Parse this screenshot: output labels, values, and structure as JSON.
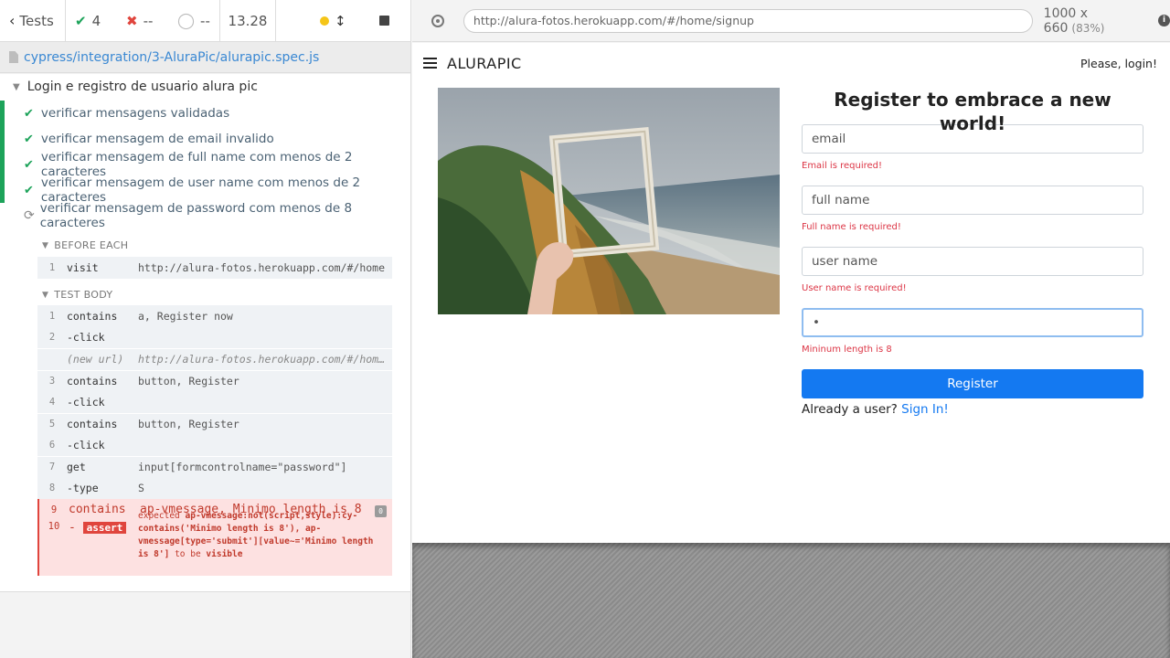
{
  "reporter": {
    "stats": {
      "back_label": "Tests",
      "passed": "4",
      "failed": "--",
      "pending": "--",
      "duration": "13.28"
    },
    "spec_path": "cypress/integration/3-AluraPic/alurapic.spec.js",
    "suite_title": "Login e registro de usuario alura pic",
    "tests": [
      {
        "title": "verificar mensagens validadas",
        "state": "passed"
      },
      {
        "title": "verificar mensagem de email invalido",
        "state": "passed"
      },
      {
        "title": "verificar mensagem de full name com menos de 2 caracteres",
        "state": "passed"
      },
      {
        "title": "verificar mensagem de user name com menos de 2 caracteres",
        "state": "passed"
      },
      {
        "title": "verificar mensagem de password com menos de 8 caracteres",
        "state": "running"
      }
    ],
    "before_each_label": "BEFORE EACH",
    "before_each": [
      {
        "n": "1",
        "name": "visit",
        "msg": "http://alura-fotos.herokuapp.com/#/home"
      }
    ],
    "test_body_label": "TEST BODY",
    "commands": [
      {
        "n": "1",
        "name": "contains",
        "msg": "a, Register now"
      },
      {
        "n": "2",
        "name": "-click",
        "msg": ""
      },
      {
        "n": "",
        "name": "(new url)",
        "msg": "http://alura-fotos.herokuapp.com/#/home/signup"
      },
      {
        "n": "3",
        "name": "contains",
        "msg": "button, Register"
      },
      {
        "n": "4",
        "name": "-click",
        "msg": ""
      },
      {
        "n": "5",
        "name": "contains",
        "msg": "button, Register"
      },
      {
        "n": "6",
        "name": "-click",
        "msg": ""
      },
      {
        "n": "7",
        "name": "get",
        "msg": "input[formcontrolname=\"password\"]"
      },
      {
        "n": "8",
        "name": "-type",
        "msg": "S"
      }
    ],
    "failed_command": {
      "n": "9",
      "name": "contains",
      "msg": "ap-vmessage, Minimo length is 8",
      "badge": "0"
    },
    "assert_command": {
      "n": "10",
      "prefix": "-",
      "name": "assert",
      "expected_word": "expected",
      "detail": "ap-vmessage:not(script,style):cy-contains('Minimo length is 8'), ap-vmessage[type='submit'][value~='Minimo length is 8']",
      "to_be": "to be",
      "visible": "visible"
    }
  },
  "aut": {
    "url": "http://alura-fotos.herokuapp.com/#/home/signup",
    "viewport": "1000 x 660",
    "zoom": "(83%)",
    "brand": "ALURAPIC",
    "login_link": "Please, login!",
    "form": {
      "title": "Register to embrace a new world!",
      "email_placeholder": "email",
      "email_error": "Email is required!",
      "fullname_placeholder": "full name",
      "fullname_error": "Full name is required!",
      "username_placeholder": "user name",
      "username_error": "User name is required!",
      "password_value": "•",
      "password_error": "Mininum length is 8",
      "register_label": "Register",
      "already_text": "Already a user?",
      "signin_label": "Sign In!"
    },
    "colors": {
      "primary": "#1479f1",
      "error": "#dc3545",
      "passed": "#1da35a",
      "failed": "#e0453d"
    }
  }
}
